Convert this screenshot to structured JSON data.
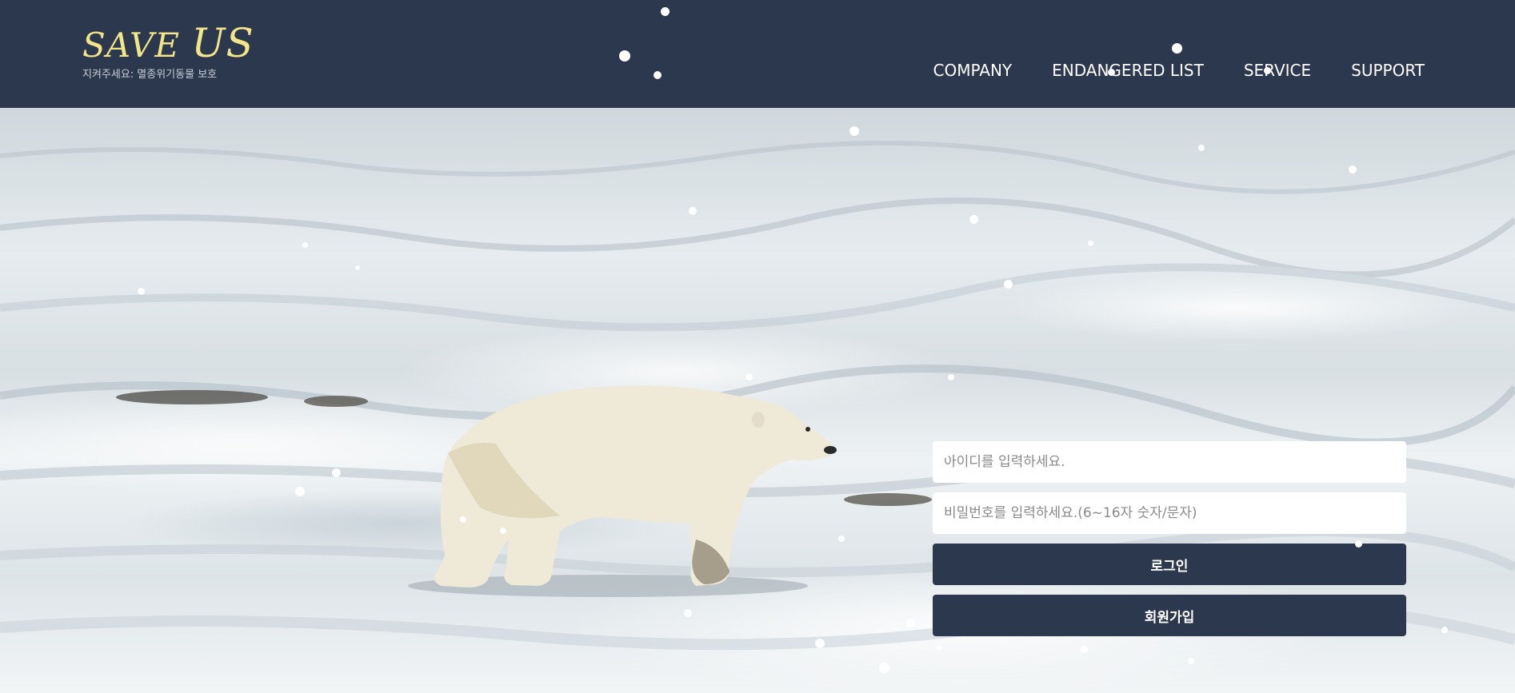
{
  "header": {
    "logo_title_small": "SAVE ",
    "logo_title_big": "US",
    "logo_subtitle": "지켜주세요: 멸종위기동물 보호",
    "nav": [
      {
        "label": "COMPANY"
      },
      {
        "label": "ENDANGERED LIST"
      },
      {
        "label": "SERVICE"
      },
      {
        "label": "SUPPORT"
      }
    ]
  },
  "login": {
    "id_placeholder": "아이디를 입력하세요.",
    "password_placeholder": "비밀번호를 입력하세요.(6~16자 숫자/문자)",
    "login_label": "로그인",
    "signup_label": "회원가입"
  },
  "colors": {
    "header_bg": "#2c384e",
    "logo": "#f2e58a",
    "button_bg": "#2c384e"
  }
}
